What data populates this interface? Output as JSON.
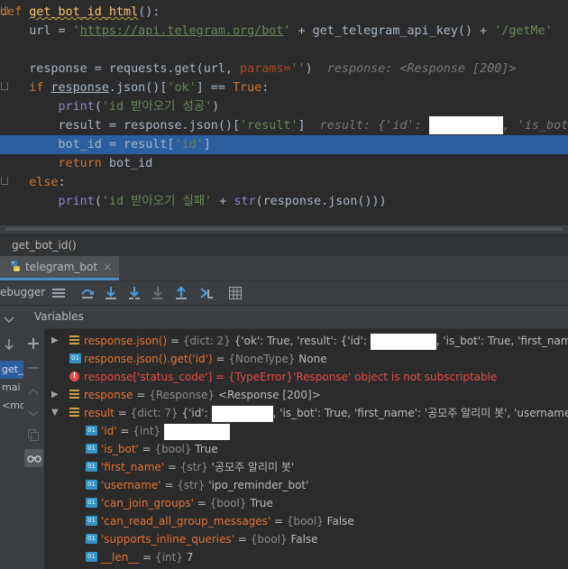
{
  "editor": {
    "lines": {
      "l1": {
        "kw": "def ",
        "fn": "get_bot_id_html",
        "rest": "():"
      },
      "l2": {
        "a": "    url = ",
        "b": "'",
        "c": "https://api.telegram.org/bot",
        "d": "'",
        "e": " + get_telegram_api_key() + ",
        "f": "'/getMe'"
      },
      "l4": {
        "a": "    response = requests.get(url, ",
        "b": "params=",
        "c": "''",
        "d": ")  ",
        "hint": "response: <Response [200]>"
      },
      "l5": {
        "kw": "    if ",
        "a": "response",
        "b": ".json()[",
        "c": "'ok'",
        "d": "] == ",
        "e": "True",
        "f": ":"
      },
      "l6": {
        "a": "        ",
        "b": "print",
        "c": "(",
        "d": "'id 받아오기 성공'",
        "e": ")"
      },
      "l7": {
        "a": "        result = response.json()[",
        "b": "'result'",
        "c": "]  ",
        "hint1": "result: {'id': ",
        "hint2": ", 'is_bot"
      },
      "l8": {
        "a": "        bot_id = result[",
        "b": "'id'",
        "c": "]"
      },
      "l9": {
        "kw": "        return ",
        "a": "bot_id"
      },
      "l10": {
        "kw": "    else",
        "a": ":"
      },
      "l11": {
        "a": "        ",
        "b": "print",
        "c": "(",
        "d": "'id 받아오기 실패'",
        "e": " + ",
        "f": "str",
        "g": "(response.json()))"
      }
    }
  },
  "breadcrumb": "get_bot_id()",
  "run_tab": {
    "label": "telegram_bot",
    "close": "×"
  },
  "toolbar": {
    "label": "ebugger"
  },
  "variables_header": "Variables",
  "threads": [
    {
      "label": "get_"
    },
    {
      "label": "mai"
    },
    {
      "label": "<mo"
    }
  ],
  "variables": [
    {
      "name": "response.json()",
      "eq": " = ",
      "type": "{dict: 2}",
      "value": " {'ok': True, 'result': {'id': ",
      "value2": ", 'is_bot': True, 'first_name': '공모주 알"
    },
    {
      "name": "response.json().get('id')",
      "eq": " = ",
      "type": "{NoneType}",
      "value": " None"
    },
    {
      "name": "response['status_code']",
      "eq": " = ",
      "type": "{TypeError}",
      "value": "'Response' object is not subscriptable"
    },
    {
      "name": "response",
      "eq": " = ",
      "type": "{Response}",
      "value": " <Response [200]>"
    },
    {
      "name": "result",
      "eq": " = ",
      "type": "{dict: 7}",
      "value": " {'id': ",
      "value2": ", 'is_bot': True, 'first_name': '공모주 알리미 봇', 'username': 'ipo_r"
    },
    {
      "name": "'id'",
      "eq": " = ",
      "type": "{int}",
      "value": ""
    },
    {
      "name": "'is_bot'",
      "eq": " = ",
      "type": "{bool}",
      "value": " True"
    },
    {
      "name": "'first_name'",
      "eq": " = ",
      "type": "{str}",
      "value": " '공모주 알리미 봇'"
    },
    {
      "name": "'username'",
      "eq": " = ",
      "type": "{str}",
      "value": " 'ipo_reminder_bot'"
    },
    {
      "name": "'can_join_groups'",
      "eq": " = ",
      "type": "{bool}",
      "value": " True"
    },
    {
      "name": "'can_read_all_group_messages'",
      "eq": " = ",
      "type": "{bool}",
      "value": " False"
    },
    {
      "name": "'supports_inline_queries'",
      "eq": " = ",
      "type": "{bool}",
      "value": " False"
    },
    {
      "name": "__len__",
      "eq": " = ",
      "type": "{int}",
      "value": " 7"
    }
  ],
  "icons": {
    "field": "01",
    "error": "!"
  },
  "colors": {
    "keyword": "#cc7832",
    "string": "#6a8759",
    "function": "#ffc66d",
    "highlight": "#2c5fa0",
    "var_name": "#e57333",
    "error": "#e74a4a"
  }
}
